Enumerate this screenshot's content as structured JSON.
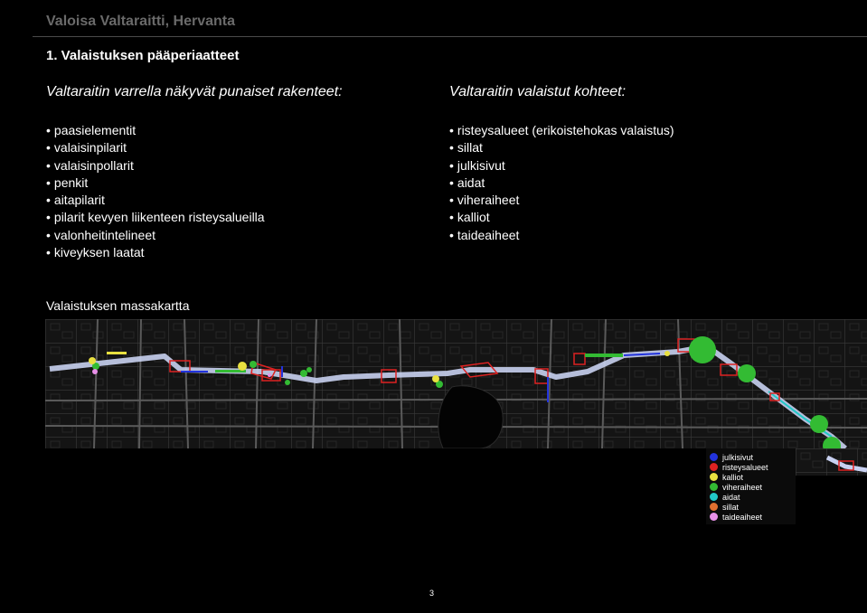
{
  "header": {
    "title": "Valoisa Valtaraitti, Hervanta"
  },
  "section": {
    "title": "1. Valaistuksen pääperiaatteet"
  },
  "left_column": {
    "heading": "Valtaraitin varrella näkyvät punaiset rakenteet:",
    "items": [
      "paasielementit",
      "valaisinpilarit",
      "valaisinpollarit",
      "penkit",
      "aitapilarit",
      "pilarit kevyen liikenteen risteysalueilla",
      "valonheitintelineet",
      "kiveyksen laatat"
    ]
  },
  "right_column": {
    "heading": "Valtaraitin valaistut kohteet:",
    "items": [
      "risteysalueet (erikoistehokas valaistus)",
      "sillat",
      "julkisivut",
      "aidat",
      "viheraiheet",
      "kalliot",
      "taideaiheet"
    ]
  },
  "map": {
    "caption": "Valaistuksen massakartta",
    "legend": [
      {
        "label": "julkisivut",
        "color": "#2233dd"
      },
      {
        "label": "risteysalueet",
        "color": "#dd2222"
      },
      {
        "label": "kalliot",
        "color": "#e8e040"
      },
      {
        "label": "viheraiheet",
        "color": "#33bb33"
      },
      {
        "label": "aidat",
        "color": "#22c8c8"
      },
      {
        "label": "sillat",
        "color": "#e07030"
      },
      {
        "label": "taideaiheet",
        "color": "#e890e8"
      }
    ]
  },
  "footer": {
    "page_number": "3"
  }
}
